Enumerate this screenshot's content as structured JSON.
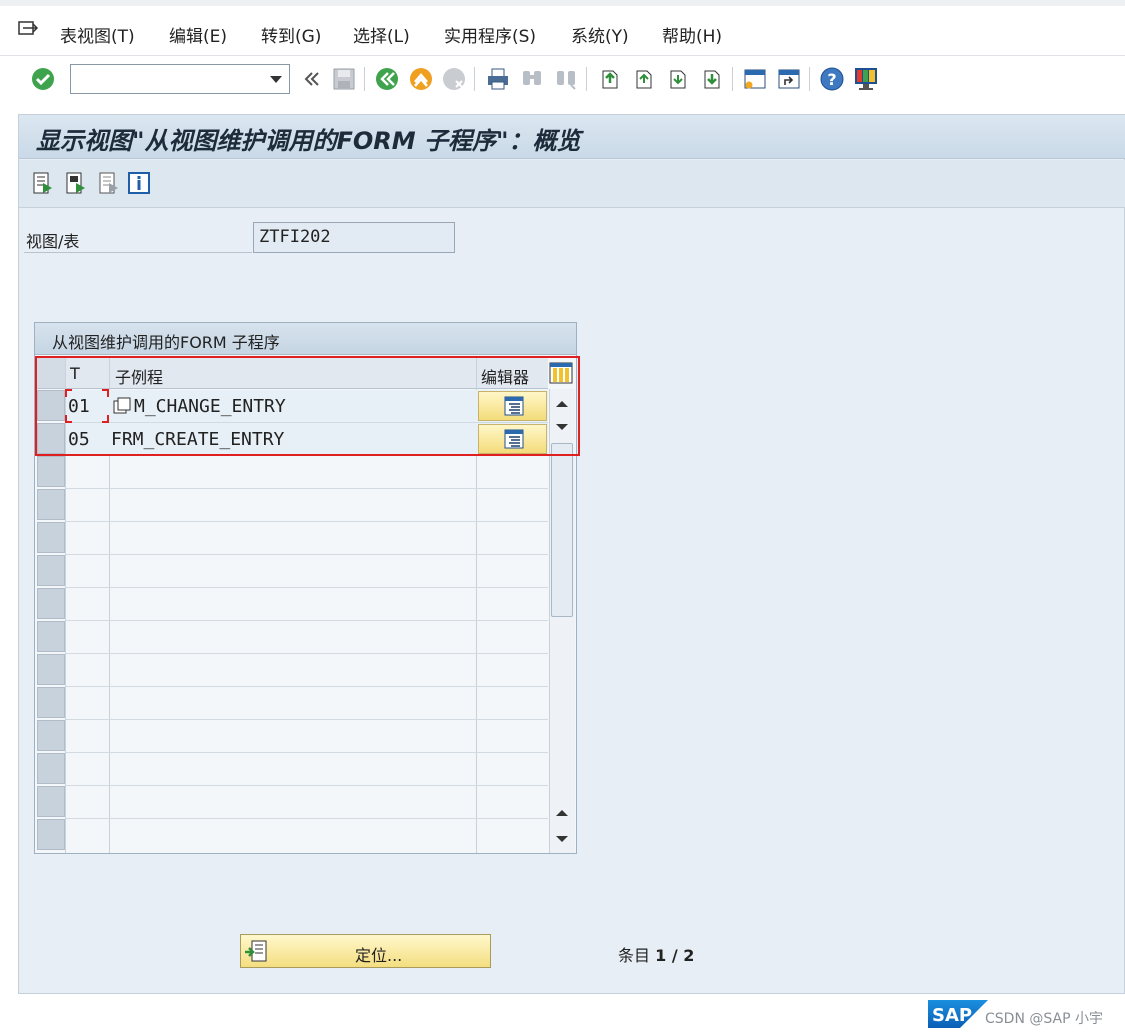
{
  "menu": {
    "items": [
      {
        "label": "表视图(T)"
      },
      {
        "label": "编辑(E)"
      },
      {
        "label": "转到(G)"
      },
      {
        "label": "选择(L)"
      },
      {
        "label": "实用程序(S)"
      },
      {
        "label": "系统(Y)"
      },
      {
        "label": "帮助(H)"
      }
    ]
  },
  "toolbar": {
    "command_value": ""
  },
  "page": {
    "title": "显示视图\"从视图维护调用的FORM 子程序\"：概览"
  },
  "view": {
    "label": "视图/表",
    "value": "ZTFI202"
  },
  "table": {
    "title": "从视图维护调用的FORM 子程序",
    "columns": {
      "t": "T",
      "routine": "子例程",
      "editor": "编辑器"
    },
    "rows": [
      {
        "t": "01",
        "routine": "M_CHANGE_ENTRY"
      },
      {
        "t": "05",
        "routine": "FRM_CREATE_ENTRY"
      }
    ]
  },
  "bottom": {
    "position_label": "定位...",
    "entry_prefix": "条目",
    "entry_count": "1 / 2"
  },
  "footer": {
    "logo_text": "SAP",
    "watermark": "CSDN @SAP 小宇"
  },
  "colors": {
    "accent_yellow": "#f4dc7a",
    "highlight_red": "#e02020",
    "panel_bg": "#e7eef5"
  }
}
